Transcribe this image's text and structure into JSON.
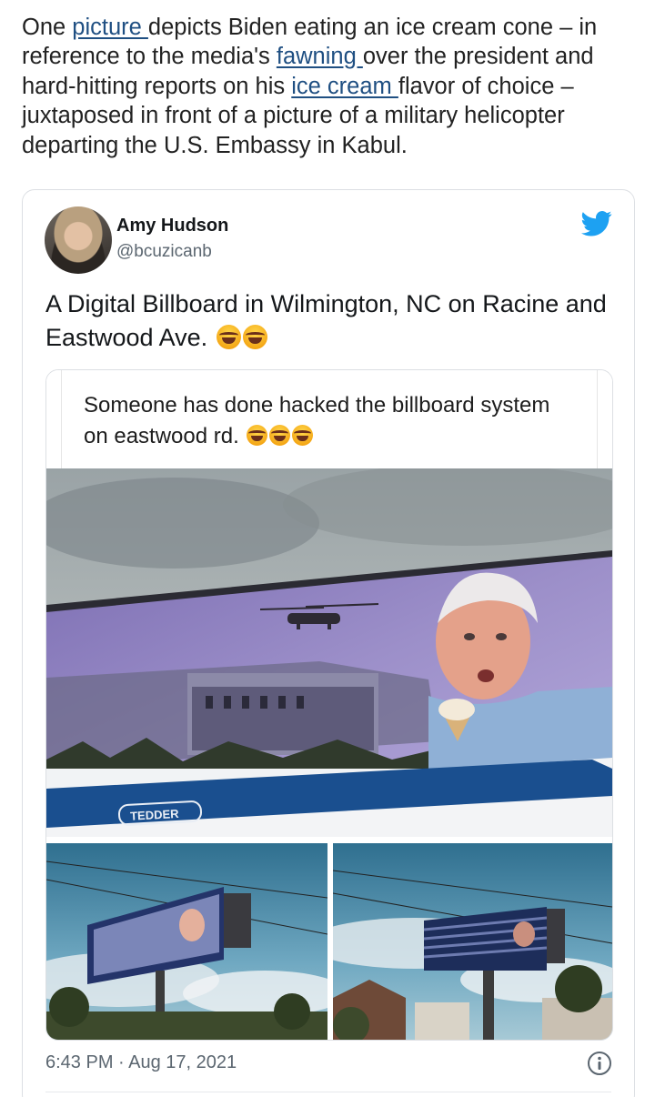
{
  "article": {
    "t1": "One ",
    "link1": "picture ",
    "t2": "depicts Biden eating an ice cream cone – in reference to the media's ",
    "link2": "fawning ",
    "t3": "over the president and hard-hitting reports on his ",
    "link3": "ice cream ",
    "t4": "flavor of choice – juxtaposed in front of a picture of a military helicopter departing the U.S. Embassy in Kabul."
  },
  "tweet": {
    "author_name": "Amy Hudson",
    "author_handle": "@bcuzicanb",
    "text": "A Digital Billboard in Wilmington, NC on Racine and Eastwood Ave.",
    "timestamp": "6:43 PM · Aug 17, 2021",
    "embedded_post_text": "Someone has done hacked the billboard system on eastwood rd.",
    "billboard_brand": "TEDDER"
  },
  "icons": {
    "brand": "twitter-bird-icon",
    "info": "info-icon",
    "emoji": "face-with-tears-of-joy"
  },
  "colors": {
    "link": "#1f4f82",
    "twitter_blue": "#1da1f2",
    "muted_text": "#5b6670"
  }
}
